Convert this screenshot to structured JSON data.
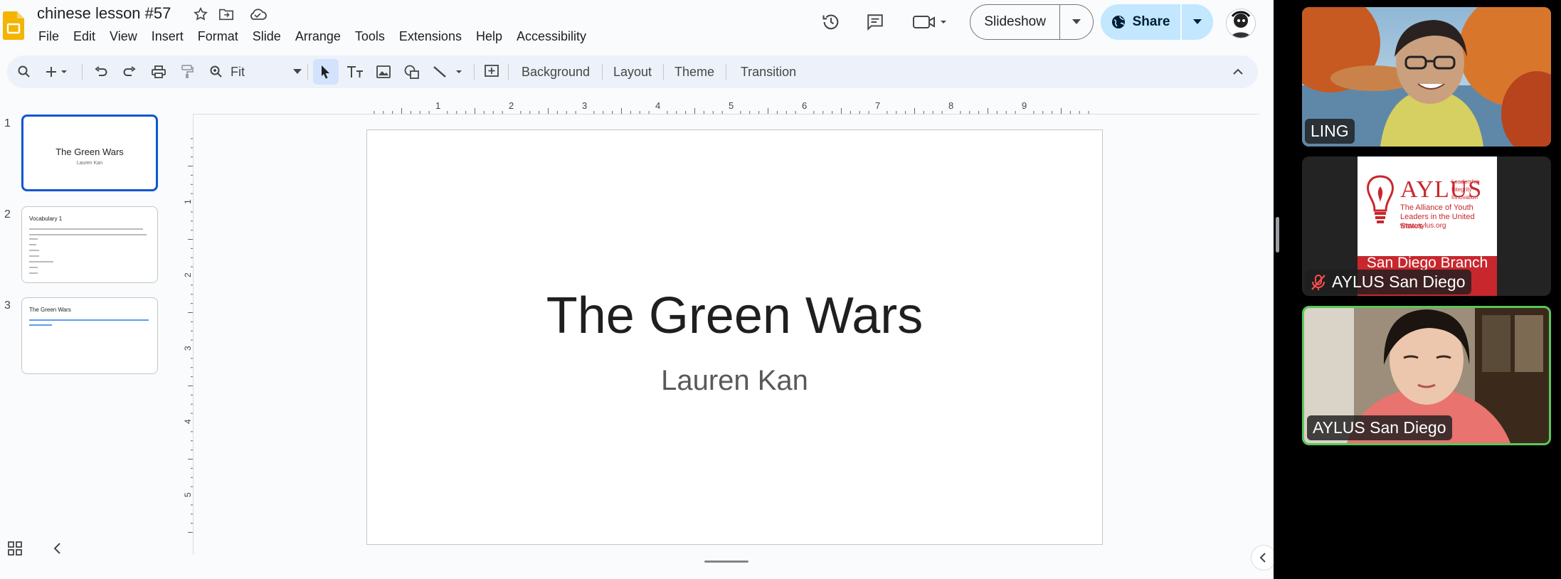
{
  "doc": {
    "title": "chinese lesson #57"
  },
  "menu": [
    "File",
    "Edit",
    "View",
    "Insert",
    "Format",
    "Slide",
    "Arrange",
    "Tools",
    "Extensions",
    "Help",
    "Accessibility"
  ],
  "header_buttons": {
    "slideshow": "Slideshow",
    "share": "Share"
  },
  "toolbar": {
    "zoom": "Fit",
    "background": "Background",
    "layout": "Layout",
    "theme": "Theme",
    "transition": "Transition"
  },
  "ruler": {
    "horizontal": [
      "1",
      "2",
      "3",
      "4",
      "5",
      "6",
      "7",
      "8",
      "9"
    ],
    "vertical": [
      "1",
      "2",
      "3",
      "4",
      "5"
    ]
  },
  "slides": [
    {
      "number": "1",
      "title": "The Green Wars",
      "subtitle": "Lauren Kan",
      "active": true
    },
    {
      "number": "2",
      "title": "Vocabulary 1",
      "active": false
    },
    {
      "number": "3",
      "title": "The Green Wars",
      "active": false
    }
  ],
  "current_slide": {
    "title": "The Green Wars",
    "subtitle": "Lauren Kan"
  },
  "participants": [
    {
      "name": "LING",
      "muted": false,
      "active_speaker": false
    },
    {
      "name": "AYLUS San Diego",
      "muted": true,
      "active_speaker": false,
      "logo": {
        "name": "AYLUS",
        "tagline": "The Alliance of Youth Leaders in the United States",
        "url": "www.aylus.org",
        "mottos": [
          "Leadership",
          "Integrity",
          "Innovation"
        ],
        "branch": "San Diego Branch"
      }
    },
    {
      "name": "AYLUS San Diego",
      "muted": false,
      "active_speaker": true
    }
  ],
  "colors": {
    "accent": "#0b57d0",
    "share_bg": "#c2e7ff",
    "active_speaker_border": "#5ac85a",
    "aylus_red": "#c8272d"
  }
}
